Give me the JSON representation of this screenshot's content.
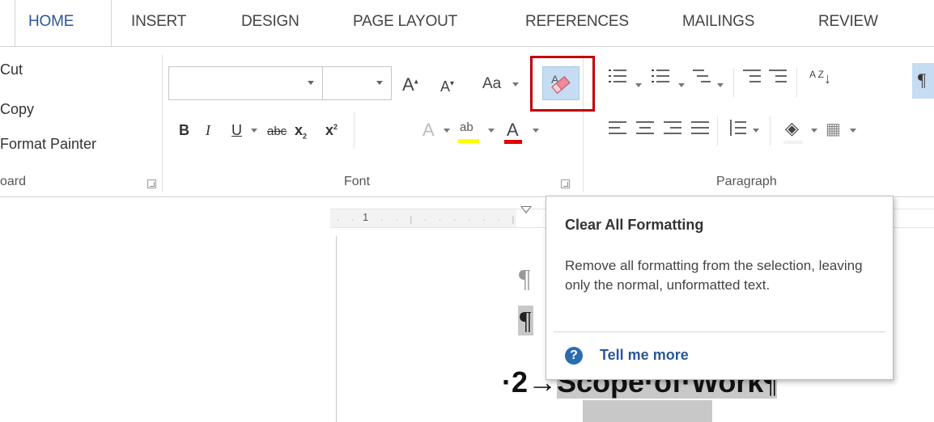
{
  "tabs": [
    {
      "label": "HOME",
      "active": true
    },
    {
      "label": "INSERT"
    },
    {
      "label": "DESIGN"
    },
    {
      "label": "PAGE LAYOUT"
    },
    {
      "label": "REFERENCES"
    },
    {
      "label": "MAILINGS"
    },
    {
      "label": "REVIEW"
    }
  ],
  "clipboard": {
    "cut": "Cut",
    "copy": "Copy",
    "format_painter": "Format Painter",
    "group_label": "oard"
  },
  "font_group": {
    "label": "Font",
    "font_name": "",
    "font_size": "",
    "grow_font": "A",
    "shrink_font": "A",
    "change_case": "Aa",
    "bold": "B",
    "italic": "I",
    "underline": "U",
    "strikethrough": "abc",
    "subscript": "x",
    "subscript_mark": "2",
    "superscript": "x",
    "superscript_mark": "2",
    "text_effects": "A",
    "highlight": "ab",
    "font_color": "A",
    "highlight_color": "#ffff00",
    "font_color_bar": "#e00000"
  },
  "paragraph_group": {
    "label": "Paragraph",
    "sort": "A Z"
  },
  "tooltip": {
    "title": "Clear All Formatting",
    "description": "Remove all formatting from the selection, leaving only the normal, unformatted text.",
    "help_icon": "?",
    "link": "Tell me more"
  },
  "ruler": {
    "number": "1"
  },
  "document": {
    "pilcrow": "¶",
    "heading_prefix": "·2→",
    "heading_text": "Scope·of·Work",
    "heading_end": "¶"
  },
  "colors": {
    "accent": "#2b579a",
    "highlight_border": "#c00000",
    "button_active": "#c5dcf2"
  }
}
